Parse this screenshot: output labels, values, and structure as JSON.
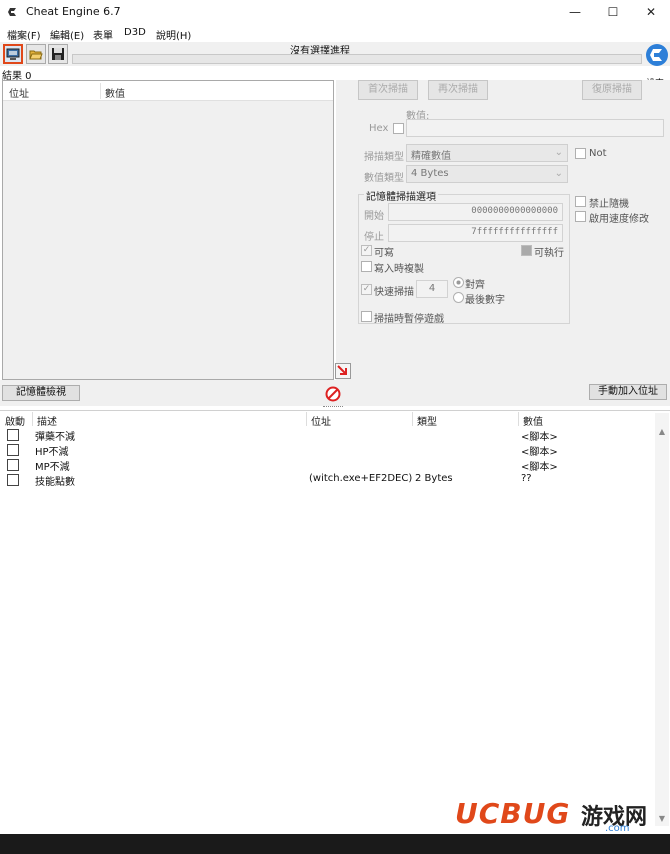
{
  "window": {
    "title": "Cheat Engine 6.7",
    "minimize": "—",
    "maximize": "☐",
    "close": "✕"
  },
  "menu": [
    "檔案(F)",
    "編輯(E)",
    "表單",
    "D3D",
    "說明(H)"
  ],
  "toolbar": {
    "process_label": "沒有選擇進程",
    "settings_label": "設定"
  },
  "results": {
    "count_label": "結果 0",
    "col_address": "位址",
    "col_value": "數值"
  },
  "scan": {
    "first_scan": "首次掃描",
    "next_scan": "再次掃描",
    "undo_scan": "復原掃描",
    "value_label": "數值:",
    "hex_label": "Hex",
    "scan_type_label": "掃描類型",
    "scan_type_value": "精確數值",
    "value_type_label": "數值類型",
    "value_type_value": "4 Bytes",
    "not_label": "Not",
    "memory_options_title": "記憶體掃描選項",
    "start_label": "開始",
    "start_value": "0000000000000000",
    "stop_label": "停止",
    "stop_value": "7fffffffffffffff",
    "writable_label": "可寫",
    "executable_label": "可執行",
    "copy_on_write_label": "寫入時複製",
    "fast_scan_label": "快速掃描",
    "fast_scan_value": "4",
    "alignment_label": "對齊",
    "last_digits_label": "最後數字",
    "pause_label": "掃描時暫停遊戲",
    "disable_random_label": "禁止隨機",
    "speedhack_label": "啟用速度修改"
  },
  "buttons": {
    "memory_view": "記憶體檢視",
    "add_address": "手動加入位址"
  },
  "addr_list": {
    "headers": [
      "啟動",
      "描述",
      "位址",
      "類型",
      "數值"
    ],
    "rows": [
      {
        "desc": "彈藥不減",
        "address": "",
        "type": "",
        "value": "<腳本>"
      },
      {
        "desc": "HP不減",
        "address": "",
        "type": "",
        "value": "<腳本>"
      },
      {
        "desc": "MP不減",
        "address": "",
        "type": "",
        "value": "<腳本>"
      },
      {
        "desc": "技能點數",
        "address": "(witch.exe+EF2DEC)",
        "type": "2 Bytes",
        "value": "??"
      }
    ]
  },
  "watermark": {
    "brand": "UCBUG",
    "cn": "游戏网",
    "domain": ".com"
  },
  "colors": {
    "accent_orange": "#e0481a",
    "logo_blue": "#2d7fd8"
  }
}
